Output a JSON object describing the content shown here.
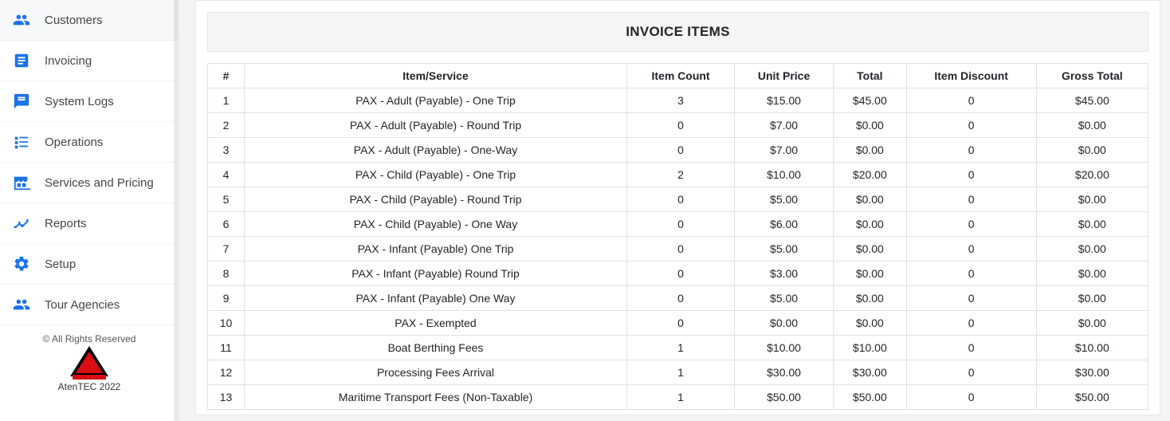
{
  "sidebar": {
    "items": [
      {
        "id": "customers",
        "label": "Customers",
        "icon": "people"
      },
      {
        "id": "invoicing",
        "label": "Invoicing",
        "icon": "doc"
      },
      {
        "id": "systemlogs",
        "label": "System Logs",
        "icon": "chat"
      },
      {
        "id": "operations",
        "label": "Operations",
        "icon": "listcheck"
      },
      {
        "id": "services",
        "label": "Services and Pricing",
        "icon": "store"
      },
      {
        "id": "reports",
        "label": "Reports",
        "icon": "trend"
      },
      {
        "id": "setup",
        "label": "Setup",
        "icon": "gear"
      },
      {
        "id": "touragencies",
        "label": "Tour Agencies",
        "icon": "people"
      }
    ]
  },
  "footer": {
    "rights": "© All Rights Reserved",
    "brand": "AtenTEC 2022"
  },
  "main": {
    "panel_title": "INVOICE ITEMS",
    "columns": {
      "num": "#",
      "item": "Item/Service",
      "count": "Item Count",
      "unit": "Unit Price",
      "total": "Total",
      "discount": "Item Discount",
      "gross": "Gross Total"
    },
    "rows": [
      {
        "num": "1",
        "item": "PAX - Adult (Payable) - One Trip",
        "count": "3",
        "unit": "$15.00",
        "total": "$45.00",
        "discount": "0",
        "gross": "$45.00"
      },
      {
        "num": "2",
        "item": "PAX - Adult (Payable) - Round Trip",
        "count": "0",
        "unit": "$7.00",
        "total": "$0.00",
        "discount": "0",
        "gross": "$0.00"
      },
      {
        "num": "3",
        "item": "PAX - Adult (Payable) - One-Way",
        "count": "0",
        "unit": "$7.00",
        "total": "$0.00",
        "discount": "0",
        "gross": "$0.00"
      },
      {
        "num": "4",
        "item": "PAX - Child (Payable) - One Trip",
        "count": "2",
        "unit": "$10.00",
        "total": "$20.00",
        "discount": "0",
        "gross": "$20.00"
      },
      {
        "num": "5",
        "item": "PAX - Child (Payable) - Round Trip",
        "count": "0",
        "unit": "$5.00",
        "total": "$0.00",
        "discount": "0",
        "gross": "$0.00"
      },
      {
        "num": "6",
        "item": "PAX - Child (Payable) - One Way",
        "count": "0",
        "unit": "$6.00",
        "total": "$0.00",
        "discount": "0",
        "gross": "$0.00"
      },
      {
        "num": "7",
        "item": "PAX - Infant (Payable) One Trip",
        "count": "0",
        "unit": "$5.00",
        "total": "$0.00",
        "discount": "0",
        "gross": "$0.00"
      },
      {
        "num": "8",
        "item": "PAX - Infant (Payable) Round Trip",
        "count": "0",
        "unit": "$3.00",
        "total": "$0.00",
        "discount": "0",
        "gross": "$0.00"
      },
      {
        "num": "9",
        "item": "PAX - Infant (Payable) One Way",
        "count": "0",
        "unit": "$5.00",
        "total": "$0.00",
        "discount": "0",
        "gross": "$0.00"
      },
      {
        "num": "10",
        "item": "PAX - Exempted",
        "count": "0",
        "unit": "$0.00",
        "total": "$0.00",
        "discount": "0",
        "gross": "$0.00"
      },
      {
        "num": "11",
        "item": "Boat Berthing Fees",
        "count": "1",
        "unit": "$10.00",
        "total": "$10.00",
        "discount": "0",
        "gross": "$10.00"
      },
      {
        "num": "12",
        "item": "Processing Fees Arrival",
        "count": "1",
        "unit": "$30.00",
        "total": "$30.00",
        "discount": "0",
        "gross": "$30.00"
      },
      {
        "num": "13",
        "item": "Maritime Transport Fees (Non-Taxable)",
        "count": "1",
        "unit": "$50.00",
        "total": "$50.00",
        "discount": "0",
        "gross": "$50.00"
      }
    ]
  }
}
